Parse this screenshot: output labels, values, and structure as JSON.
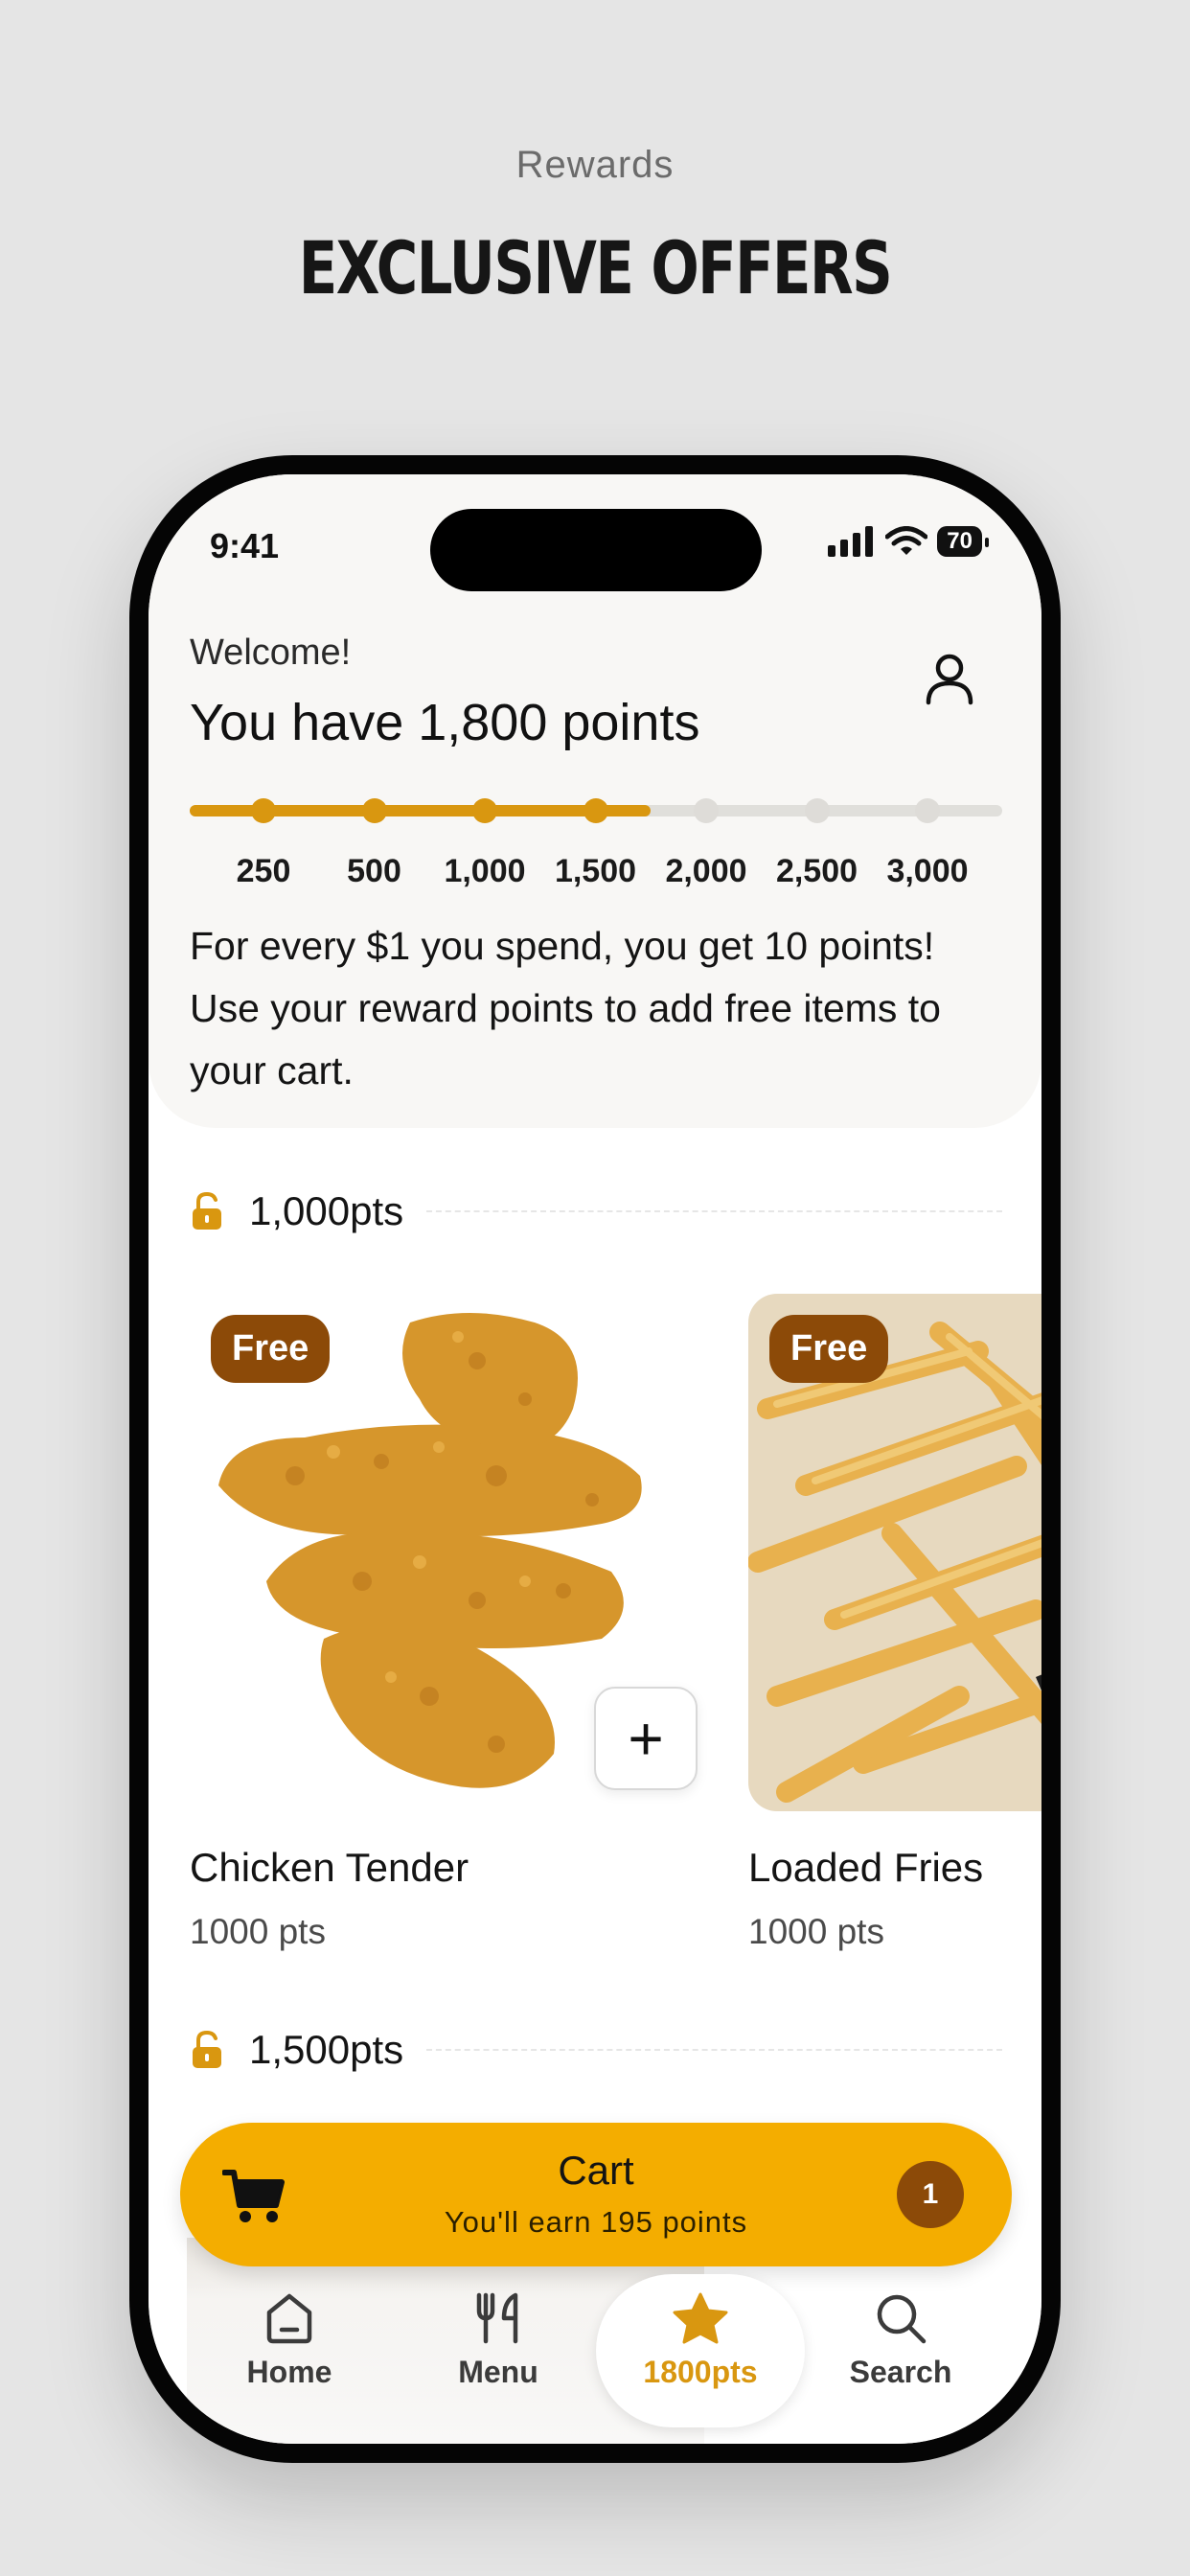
{
  "page": {
    "eyebrow": "Rewards",
    "headline": "EXCLUSIVE OFFERS"
  },
  "status_bar": {
    "time": "9:41",
    "battery": "70"
  },
  "header": {
    "welcome": "Welcome!",
    "points_title": "You have 1,800 points",
    "profile_icon": "person-icon"
  },
  "progress": {
    "current_points": 1800,
    "max_points": 3000,
    "milestones": [
      "250",
      "500",
      "1,000",
      "1,500",
      "2,000",
      "2,500",
      "3,000"
    ],
    "reached_count": 4,
    "accent_color": "#d99710"
  },
  "info_text": "For every $1 you spend, you get 10 points! Use your reward points to add free items to your cart.",
  "tiers": [
    {
      "label": "1,000pts",
      "products": [
        {
          "badge": "Free",
          "name": "Chicken Tender",
          "points": "1000 pts",
          "add_label": "+"
        },
        {
          "badge": "Free",
          "name": "Loaded Fries",
          "points": "1000 pts"
        }
      ]
    },
    {
      "label": "1,500pts"
    }
  ],
  "cart": {
    "title": "Cart",
    "subtitle": "You'll earn 195 points",
    "count": "1",
    "color": "#f4ad00"
  },
  "tabbar": {
    "items": [
      {
        "label": "Home",
        "icon": "home-icon"
      },
      {
        "label": "Menu",
        "icon": "utensils-icon"
      },
      {
        "label": "1800pts",
        "icon": "star-icon",
        "active": true
      },
      {
        "label": "Search",
        "icon": "search-icon"
      }
    ]
  }
}
